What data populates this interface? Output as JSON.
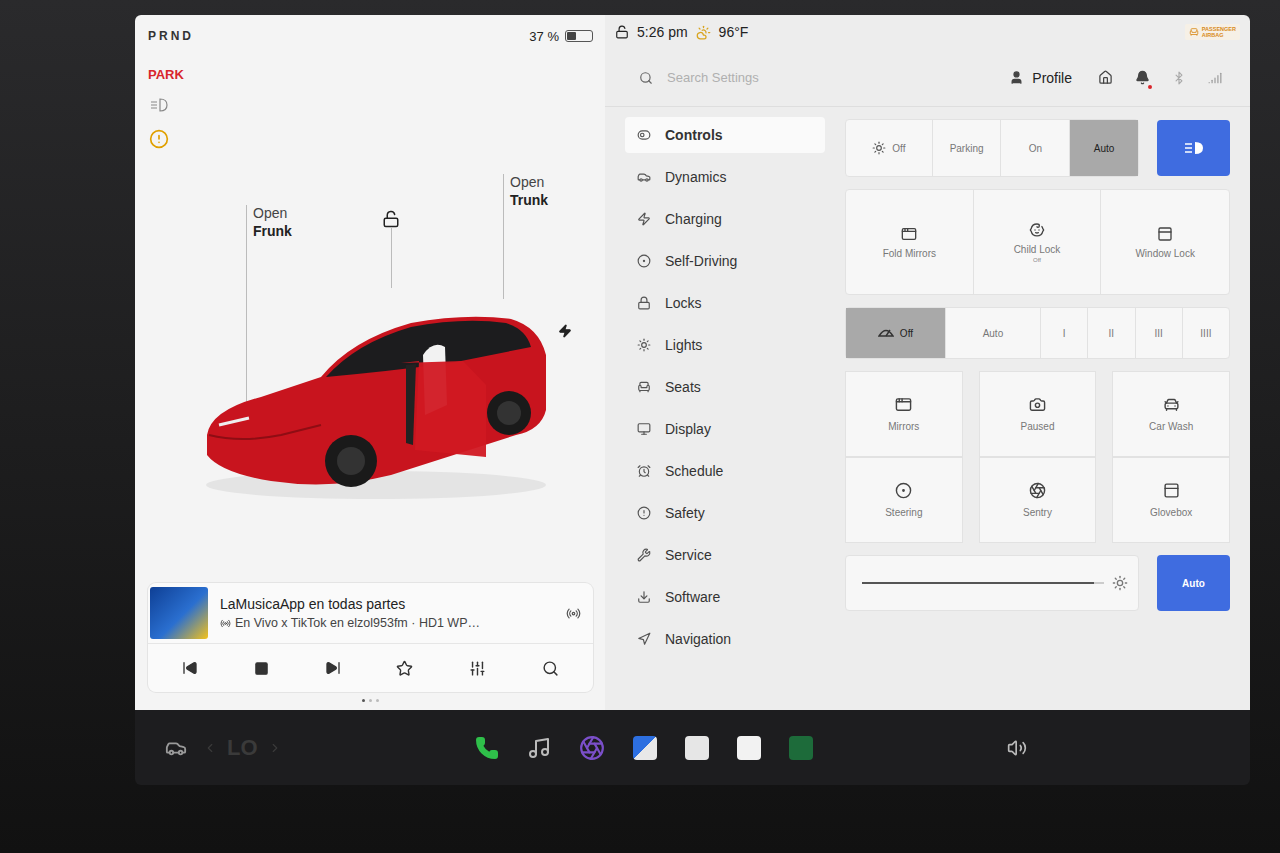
{
  "gear": {
    "selector": "PRND",
    "state": "PARK"
  },
  "battery": {
    "percent": "37 %",
    "level": 0.37
  },
  "vehicle": {
    "frunk": {
      "line1": "Open",
      "line2": "Frunk"
    },
    "trunk": {
      "line1": "Open",
      "line2": "Trunk"
    },
    "locked": false,
    "door_open": true
  },
  "media": {
    "title": "LaMusicaApp en todas partes",
    "subtitle": "En Vivo x TikTok en elzol953fm · HD1 WP…",
    "playing": true,
    "favorite": false
  },
  "pager": [
    {
      "selected": true
    },
    {
      "selected": false
    },
    {
      "selected": false
    }
  ],
  "status": {
    "locked": false,
    "time": "5:26 pm",
    "temperature": "96°F"
  },
  "airbag": {
    "line1": "PASSENGER",
    "line2": "AIRBAG"
  },
  "search": {
    "placeholder": "Search Settings"
  },
  "profile": {
    "label": "Profile",
    "notification": true
  },
  "menu": [
    {
      "label": "Controls",
      "selected": true
    },
    {
      "label": "Dynamics",
      "selected": false
    },
    {
      "label": "Charging",
      "selected": false
    },
    {
      "label": "Self-Driving",
      "selected": false
    },
    {
      "label": "Locks",
      "selected": false
    },
    {
      "label": "Lights",
      "selected": false
    },
    {
      "label": "Seats",
      "selected": false
    },
    {
      "label": "Display",
      "selected": false
    },
    {
      "label": "Schedule",
      "selected": false
    },
    {
      "label": "Safety",
      "selected": false
    },
    {
      "label": "Service",
      "selected": false
    },
    {
      "label": "Software",
      "selected": false
    },
    {
      "label": "Navigation",
      "selected": false
    }
  ],
  "headlights": {
    "options": [
      {
        "label": "Off",
        "selected": false
      },
      {
        "label": "Parking",
        "selected": false
      },
      {
        "label": "On",
        "selected": false
      },
      {
        "label": "Auto",
        "selected": true
      }
    ],
    "auto_high_beam": true
  },
  "toggles": [
    {
      "label": "Fold Mirrors",
      "sub": ""
    },
    {
      "label": "Child Lock",
      "sub": "Off"
    },
    {
      "label": "Window Lock",
      "sub": ""
    }
  ],
  "wipers": [
    {
      "label": "Off",
      "selected": true
    },
    {
      "label": "Auto",
      "selected": false
    },
    {
      "label": "I",
      "selected": false
    },
    {
      "label": "II",
      "selected": false
    },
    {
      "label": "III",
      "selected": false
    },
    {
      "label": "IIII",
      "selected": false
    }
  ],
  "tiles": [
    {
      "label": "Mirrors"
    },
    {
      "label": "Paused"
    },
    {
      "label": "Car Wash"
    },
    {
      "label": "Steering"
    },
    {
      "label": "Sentry"
    },
    {
      "label": "Glovebox"
    }
  ],
  "brightness": {
    "level": 0.96,
    "auto_label": "Auto",
    "auto": true
  },
  "dock": {
    "temperature": "LO"
  }
}
